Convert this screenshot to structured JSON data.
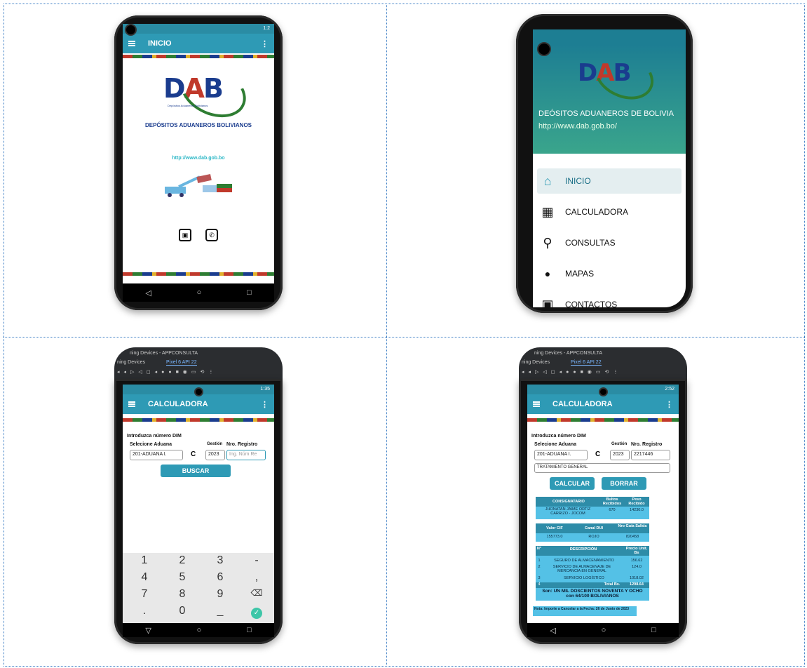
{
  "panel1": {
    "status_time": "1:2",
    "app_title": "INICIO",
    "logo_text": {
      "d": "D",
      "a": "A",
      "b": "B"
    },
    "logo_subtitle": "Depósitos Aduaneros Bolivianos",
    "company_name": "DEPÓSITOS ADUANEROS BOLIVIANOS",
    "website": "http://www.dab.gob.bo"
  },
  "panel2": {
    "drawer_title": "DEÓSITOS ADUANEROS DE BOLIVIA",
    "drawer_url": "http://www.dab.gob.bo/",
    "menu": [
      {
        "label": "INICIO",
        "icon": "home-icon",
        "glyph": "⌂"
      },
      {
        "label": "CALCULADORA",
        "icon": "calculator-icon",
        "glyph": "▦"
      },
      {
        "label": "CONSULTAS",
        "icon": "search-icon",
        "glyph": "⚲"
      },
      {
        "label": "MAPAS",
        "icon": "map-pin-icon",
        "glyph": "⬤"
      },
      {
        "label": "CONTACTOS",
        "icon": "contact-icon",
        "glyph": "▣"
      }
    ]
  },
  "panel3": {
    "ide_title": "ning Devices - APPCONSULTA",
    "ide_tab_devices": "ning Devices",
    "ide_tab_pixel": "Pixel 6 API 22",
    "status_time": "1:35",
    "app_title": "CALCULADORA",
    "intro_label": "Introduzca número DIM",
    "aduana_label": "Selecione Aduana",
    "gestion_label": "Gestión",
    "registro_label": "Nro. Registro",
    "aduana_value": "201-ADUANA I.",
    "c_label": "C",
    "gestion_value": "2023",
    "registro_placeholder": "Ing. Núm Re",
    "buscar_label": "BUSCAR",
    "keys": [
      "1",
      "2",
      "3",
      "-",
      "4",
      "5",
      "6",
      ",",
      "7",
      "8",
      "9",
      "⌫",
      ".",
      "0",
      "_",
      "✓"
    ]
  },
  "panel4": {
    "ide_title": "ning Devices - APPCONSULTA",
    "ide_tab_devices": "ning Devices",
    "ide_tab_pixel": "Pixel 6 API 22",
    "status_time": "2:52",
    "app_title": "CALCULADORA",
    "intro_label": "Introduzca número DIM",
    "aduana_label": "Selecione Aduana",
    "gestion_label": "Gestión",
    "registro_label": "Nro. Registro",
    "aduana_value": "201-ADUANA I.",
    "c_label": "C",
    "gestion_value": "2023",
    "registro_value": "2217446",
    "tratamiento": "TRATAMIENTO GENERAL",
    "calcular_label": "CALCULAR",
    "borrar_label": "BORRAR",
    "t1": {
      "h_consignatario": "CONSIGNATARIO",
      "h_bultos": "Bultos Recibidos",
      "h_peso": "Peso Recibido",
      "consignatario": "JHONATAN JAIME ORTIZ CARRIZO - JOCOM",
      "bultos": "670",
      "peso": "14230.0"
    },
    "t2": {
      "h_valor": "Valor CIF",
      "h_canal": "Canal DUI",
      "h_guia": "Nro Guía Salida",
      "valor": "155773.0",
      "canal": "ROJO",
      "guia": "820458"
    },
    "t3": {
      "h_n": "N°",
      "h_desc": "DESCRIPCIÓN",
      "h_precio": "Precio Unit. Bs",
      "rows": [
        {
          "n": "1",
          "desc": "SEGURO DE ALMACENAMIENTO",
          "precio": "156.62"
        },
        {
          "n": "2",
          "desc": "SERVICIO DE ALMACENAJE DE MERCANCIA EN GENERAL",
          "precio": "124.0"
        },
        {
          "n": "3",
          "desc": "SERVICIO LOGÍSTICO",
          "precio": "1018.02"
        }
      ],
      "total_label": "Total Bs.",
      "total_value": "1298.64",
      "total_n": "4"
    },
    "son": "Son: UN MIL DOSCIENTOS NOVENTA Y OCHO con 64/100 BOLIVIANOS",
    "nota": "Nota: Importe a Cancelar a la Fecha: 26 de Junio de 2023"
  }
}
